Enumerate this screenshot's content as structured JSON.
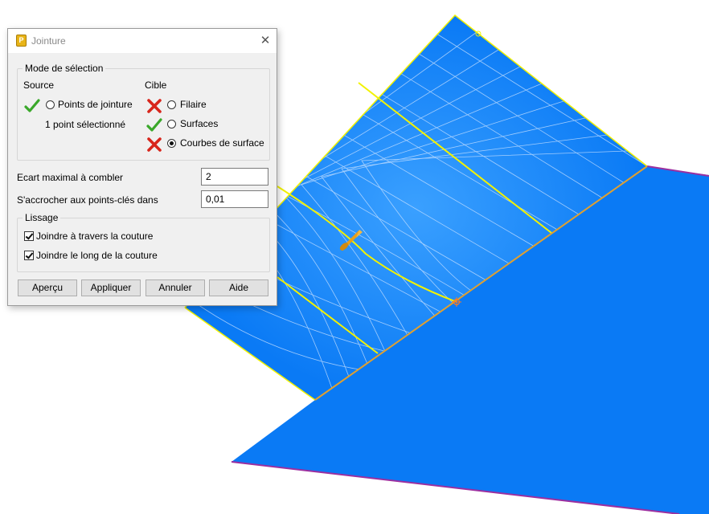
{
  "dialog": {
    "title": "Jointure",
    "close_symbol": "✕",
    "selection_mode": {
      "legend": "Mode de sélection",
      "source": {
        "heading": "Source",
        "option_label": "Points de jointure",
        "status": "1 point sélectionné"
      },
      "target": {
        "heading": "Cible",
        "options": [
          {
            "label": "Filaire",
            "icon": "red-cross-icon",
            "selected": false
          },
          {
            "label": "Surfaces",
            "icon": "green-check-icon",
            "selected": false
          },
          {
            "label": "Courbes de surface",
            "icon": "red-cross-icon",
            "selected": true
          }
        ]
      }
    },
    "fields": {
      "max_gap_label": "Ecart maximal à combler",
      "max_gap_value": "2",
      "snap_label": "S'accrocher aux points-clés dans",
      "snap_value": "0,01"
    },
    "smoothing": {
      "legend": "Lissage",
      "across_seam_label": "Joindre à travers la couture",
      "across_seam_checked": true,
      "along_seam_label": "Joindre le long de la couture",
      "along_seam_checked": true
    },
    "buttons": {
      "preview": "Aperçu",
      "apply": "Appliquer",
      "cancel": "Annuler",
      "help": "Aide"
    }
  },
  "colors": {
    "surface": "#0a7af5",
    "edge_yellow": "#f2f200",
    "edge_orange": "#e0a030",
    "edge_purple": "#9b2fa0",
    "check_green": "#3aa82a",
    "cross_red": "#d8261c"
  }
}
